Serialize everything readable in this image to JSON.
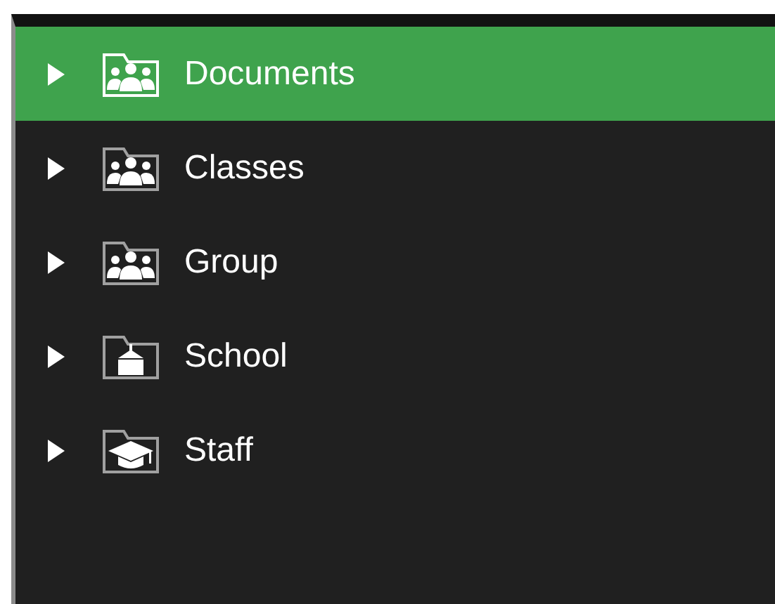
{
  "tree": {
    "items": [
      {
        "label": "Documents",
        "kind": "people",
        "selected": true,
        "expanded": false
      },
      {
        "label": "Classes",
        "kind": "people",
        "selected": false,
        "expanded": false
      },
      {
        "label": "Group",
        "kind": "people",
        "selected": false,
        "expanded": false
      },
      {
        "label": "School",
        "kind": "building",
        "selected": false,
        "expanded": false
      },
      {
        "label": "Staff",
        "kind": "cap",
        "selected": false,
        "expanded": false
      }
    ]
  }
}
